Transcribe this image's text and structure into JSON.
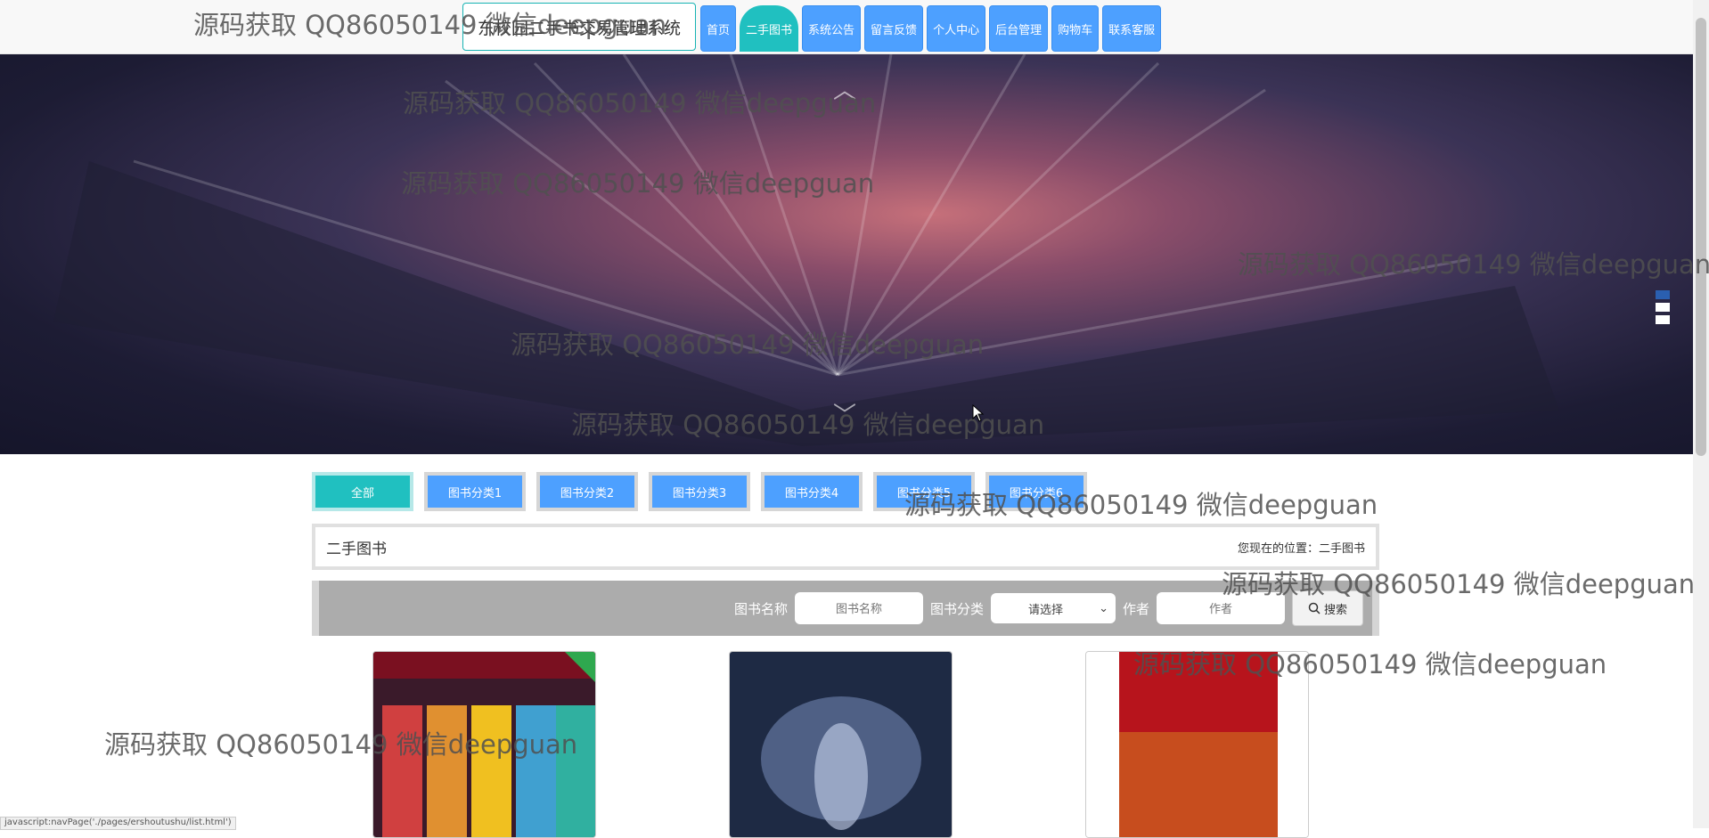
{
  "header": {
    "site_title": "东校园二手书交易管理系统",
    "nav": [
      "首页",
      "二手图书",
      "系统公告",
      "留言反馈",
      "个人中心",
      "后台管理",
      "购物车",
      "联系客服"
    ],
    "active_nav": "二手图书"
  },
  "categories": [
    "全部",
    "图书分类1",
    "图书分类2",
    "图书分类3",
    "图书分类4",
    "图书分类5",
    "图书分类6"
  ],
  "breadcrumb": {
    "title": "二手图书",
    "location": "您现在的位置：二手图书"
  },
  "search": {
    "name_label": "图书名称",
    "name_placeholder": "图书名称",
    "category_label": "图书分类",
    "category_value": "请选择",
    "author_label": "作者",
    "author_placeholder": "作者",
    "button": "搜索"
  },
  "status_text": "javascript:navPage('./pages/ershoutushu/list.html')",
  "watermark": "源码获取 QQ86050149 微信deepguan",
  "colors": {
    "primary": "#4da0ff",
    "accent": "#20c0c0"
  }
}
